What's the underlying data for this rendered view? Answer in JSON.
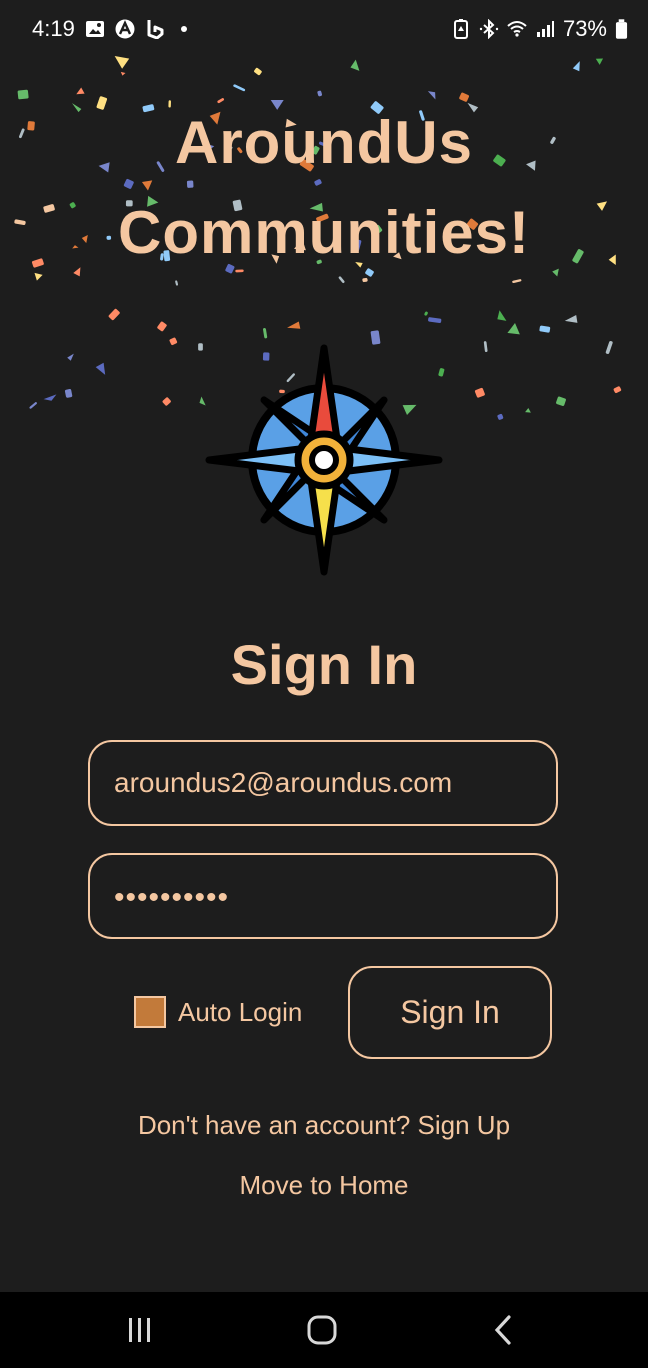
{
  "status_bar": {
    "time": "4:19",
    "battery": "73%",
    "icons_left": [
      "gallery-icon",
      "app-a-icon",
      "bing-icon",
      "notification-dot"
    ],
    "icons_right": [
      "battery-saver-icon",
      "bluetooth-icon",
      "wifi-icon",
      "signal-icon",
      "battery-icon"
    ]
  },
  "app": {
    "title_line1": "AroundUs",
    "title_line2": "Communities!",
    "logo": "compass-icon"
  },
  "form": {
    "heading": "Sign In",
    "email_value": "aroundus2@aroundus.com",
    "password_masked": "••••••••••",
    "auto_login_label": "Auto Login",
    "auto_login_checked": true,
    "signin_button": "Sign In"
  },
  "links": {
    "signup": "Don't have an account? Sign Up",
    "home": "Move to Home"
  },
  "nav_bar": {
    "buttons": [
      "recents-icon",
      "home-icon",
      "back-icon"
    ]
  },
  "colors": {
    "background": "#1d1d1d",
    "accent": "#f4c7a1",
    "checkbox": "#c27a3a",
    "nav": "#000000"
  }
}
